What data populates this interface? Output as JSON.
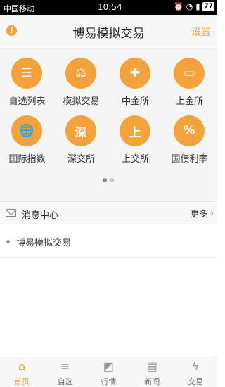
{
  "status_bar": {
    "carrier": "中国移动",
    "time": "10:54",
    "battery": "77"
  },
  "header": {
    "info_icon": "i",
    "title": "博易模拟交易",
    "settings_label": "设置"
  },
  "grid": {
    "items": [
      {
        "label": "自选列表",
        "icon": "list-icon",
        "glyph": "☰"
      },
      {
        "label": "模拟交易",
        "icon": "gavel-icon",
        "glyph": "⚖"
      },
      {
        "label": "中金所",
        "icon": "cfe-icon",
        "glyph": "✚"
      },
      {
        "label": "上金所",
        "icon": "gold-bar-icon",
        "glyph": "▭"
      },
      {
        "label": "国际指数",
        "icon": "globe-chart-icon",
        "glyph": "🌐"
      },
      {
        "label": "深交所",
        "icon": "szse-icon",
        "glyph": "深"
      },
      {
        "label": "上交所",
        "icon": "sse-icon",
        "glyph": "上"
      },
      {
        "label": "国债利率",
        "icon": "bond-rate-icon",
        "glyph": "%"
      }
    ]
  },
  "pager": {
    "pages": 2,
    "active": 0
  },
  "messages": {
    "title": "消息中心",
    "more_label": "更多",
    "chevron": "›",
    "items": [
      "博易模拟交易"
    ]
  },
  "tab_bar": {
    "tabs": [
      {
        "label": "首页",
        "icon": "home-icon",
        "glyph": "⌂",
        "active": true
      },
      {
        "label": "自选",
        "icon": "watchlist-icon",
        "glyph": "≡",
        "active": false
      },
      {
        "label": "行情",
        "icon": "market-chart-icon",
        "glyph": "◩",
        "active": false
      },
      {
        "label": "新闻",
        "icon": "news-icon",
        "glyph": "▤",
        "active": false
      },
      {
        "label": "交易",
        "icon": "trade-lightning-icon",
        "glyph": "ϟ",
        "active": false
      }
    ]
  },
  "colors": {
    "accent": "#f3a23c",
    "header_bg": "#f7f7f7",
    "grid_bg": "#f5f5f5"
  }
}
